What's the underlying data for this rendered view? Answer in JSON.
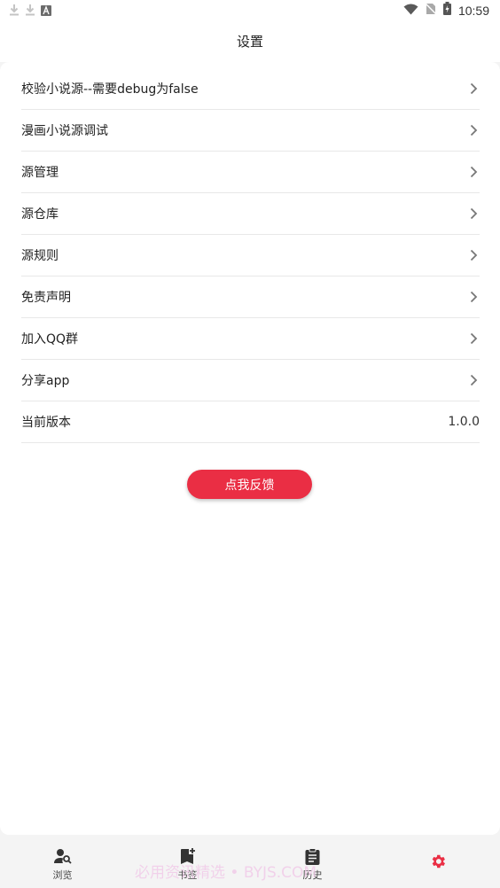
{
  "status_bar": {
    "time": "10:59",
    "left_icons": [
      "download-icon",
      "download-icon",
      "font-a-icon"
    ],
    "right_icons": [
      "wifi-icon",
      "no-sim-icon",
      "battery-charging-icon"
    ]
  },
  "header": {
    "title": "设置"
  },
  "settings": {
    "items": [
      {
        "label": "校验小说源--需要debug为false",
        "trailing": "chevron-right-icon"
      },
      {
        "label": "漫画小说源调试",
        "trailing": "chevron-right-icon"
      },
      {
        "label": "源管理",
        "trailing": "chevron-right-icon"
      },
      {
        "label": "源仓库",
        "trailing": "chevron-right-icon"
      },
      {
        "label": "源规则",
        "trailing": "chevron-right-icon"
      },
      {
        "label": "免责声明",
        "trailing": "chevron-right-icon"
      },
      {
        "label": "加入QQ群",
        "trailing": "chevron-right-icon"
      },
      {
        "label": "分享app",
        "trailing": "chevron-right-icon"
      },
      {
        "label": "当前版本",
        "value": "1.0.0"
      }
    ]
  },
  "feedback_button": {
    "label": "点我反馈"
  },
  "bottom_nav": {
    "items": [
      {
        "label": "浏览",
        "icon": "person-search-icon"
      },
      {
        "label": "书签",
        "icon": "bookmark-add-icon"
      },
      {
        "label": "历史",
        "icon": "clipboard-icon"
      },
      {
        "label": "",
        "icon": "gear-icon",
        "active": true
      }
    ]
  },
  "watermark": {
    "text": "必用资讯精选 • BYJS.COM"
  },
  "colors": {
    "accent": "#ea2e44",
    "divider": "#e8e8e8",
    "background": "#f4f4f4"
  }
}
